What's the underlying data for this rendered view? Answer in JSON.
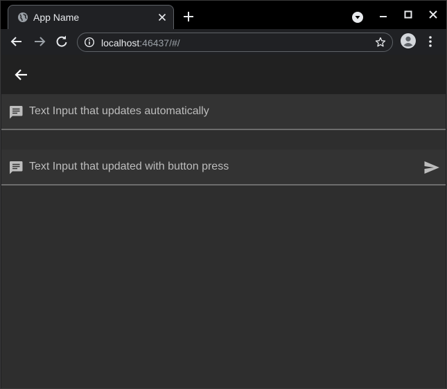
{
  "browser": {
    "tab_title": "App Name",
    "url_host": "localhost",
    "url_rest": ":46437/#/"
  },
  "fields": [
    {
      "placeholder": "Text Input that updates automatically",
      "value": ""
    },
    {
      "placeholder": "Text Input that updated with button press",
      "value": ""
    }
  ],
  "colors": {
    "page_background": "#2e2e2e",
    "appbar_background": "#212121",
    "field_underline": "#6d6d6d"
  },
  "icons": {
    "favicon": "globe-icon",
    "tab_close": "close-icon",
    "new_tab": "plus-icon",
    "tab_search": "tab-search-icon",
    "minimize": "minimize-icon",
    "maximize": "maximize-icon",
    "window_close": "close-icon",
    "nav_back": "arrow-left-icon",
    "nav_forward": "arrow-right-icon",
    "reload": "reload-icon",
    "site_info": "info-icon",
    "bookmark": "star-icon",
    "profile": "profile-icon",
    "menu": "kebab-menu-icon",
    "app_back": "arrow-left-icon",
    "field_icon": "message-icon",
    "send": "send-icon"
  }
}
